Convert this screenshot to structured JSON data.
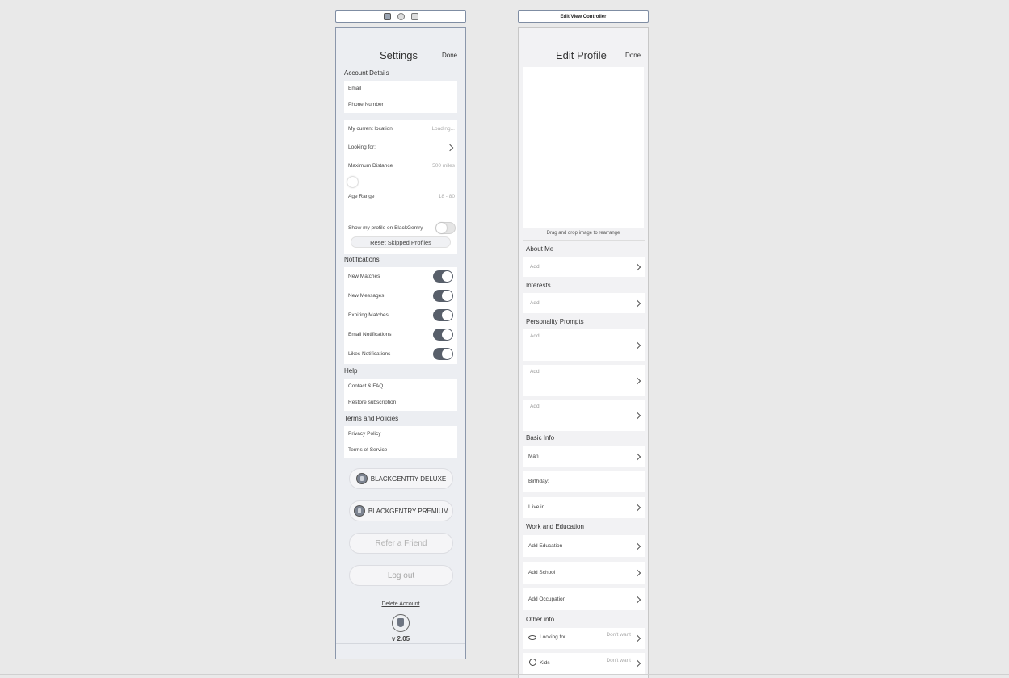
{
  "settings_scene": {
    "nav": {
      "title": "Settings",
      "done": "Done"
    },
    "account_details": {
      "header": "Account Details",
      "rows": [
        "Email",
        "Phone Number"
      ]
    },
    "discovery": {
      "location_label": "My current location",
      "location_value": "Loading...",
      "looking_for_label": "Looking for:",
      "max_distance_label": "Maximum Distance",
      "max_distance_value": "500 miles",
      "distance_slider_level": 0.0,
      "age_range_label": "Age Range",
      "age_range_value": "18 - 80",
      "show_profile_label": "Show my profile on BlackGentry",
      "show_profile_on": false,
      "reset_button": "Reset Skipped Profiles"
    },
    "notifications": {
      "header": "Notifications",
      "rows": [
        {
          "label": "New Matches",
          "on": true
        },
        {
          "label": "New Messages",
          "on": true
        },
        {
          "label": "Expiring Matches",
          "on": true
        },
        {
          "label": "Email Notifications",
          "on": true
        },
        {
          "label": "Likes Notifications",
          "on": true
        }
      ]
    },
    "help": {
      "header": "Help",
      "rows": [
        "Contact & FAQ",
        "Restore subscription"
      ]
    },
    "terms": {
      "header": "Terms and Policies",
      "rows": [
        "Privacy Policy",
        "Terms of Service"
      ]
    },
    "buttons": {
      "deluxe": "BLACKGENTRY DELUXE",
      "premium": "BLACKGENTRY PREMIUM",
      "refer": "Refer a Friend",
      "logout": "Log out",
      "delete": "Delete Account"
    },
    "version": "v 2.05"
  },
  "edit_scene": {
    "scene_title": "Edit View Controller",
    "nav": {
      "title": "Edit Profile",
      "done": "Done"
    },
    "photo_hint": "Drag and drop image to rearrange",
    "about_me": {
      "header": "About Me",
      "placeholder": "Add"
    },
    "interests": {
      "header": "Interests",
      "placeholder": "Add"
    },
    "prompts": {
      "header": "Personality Prompts",
      "rows": [
        "Add",
        "Add",
        "Add"
      ]
    },
    "basic_info": {
      "header": "Basic Info",
      "gender": "Man",
      "birthday": "Birthday:",
      "live_in": "I live in"
    },
    "work": {
      "header": "Work and Education",
      "rows": [
        "Add Education",
        "Add School",
        "Add Occupation"
      ]
    },
    "other": {
      "header": "Other info",
      "rows": [
        {
          "label": "Looking for",
          "value": "Don't want",
          "icon": "eye-icon"
        },
        {
          "label": "Kids",
          "value": "Don't want",
          "icon": "baby-icon"
        }
      ]
    }
  }
}
